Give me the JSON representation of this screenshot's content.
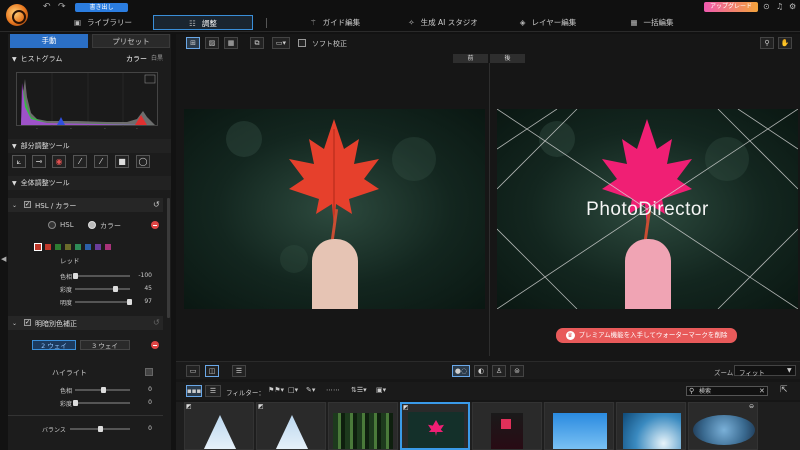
{
  "top": {
    "export_label": "書き出し",
    "upgrade_label": "アップグレード",
    "tabs": [
      {
        "label": "ライブラリー",
        "icon": "library-icon"
      },
      {
        "label": "調整",
        "icon": "adjust-icon"
      },
      {
        "label": "ガイド編集",
        "icon": "wand-icon"
      },
      {
        "label": "生成 AI スタジオ",
        "icon": "sparkle-icon"
      },
      {
        "label": "レイヤー編集",
        "icon": "layers-icon"
      },
      {
        "label": "一括編集",
        "icon": "batch-icon"
      }
    ]
  },
  "left": {
    "tab_manual": "手動",
    "tab_preset": "プリセット",
    "histogram_title": "ヒストグラム",
    "histogram_mode_color": "カラー",
    "histogram_mode_white": "白黒",
    "partial_tools_title": "部分調整ツール",
    "global_tools_title": "全体調整ツール",
    "hsl_title": "HSL / カラー",
    "hsl_option_hsl": "HSL",
    "hsl_option_color": "カラー",
    "color_name": "レッド",
    "sliders": [
      {
        "label": "色相",
        "value": "-100",
        "pos": 0.0
      },
      {
        "label": "彩度",
        "value": "45",
        "pos": 0.72
      },
      {
        "label": "明度",
        "value": "97",
        "pos": 0.98
      }
    ],
    "split_title": "明暗別色補正",
    "two_way": "2 ウェイ",
    "three_way": "3 ウェイ",
    "highlight_label": "ハイライト",
    "split_sliders": [
      {
        "label": "色相",
        "value": "0",
        "pos": 0.5
      },
      {
        "label": "彩度",
        "value": "0",
        "pos": 0.0
      }
    ],
    "balance_label": "バランス",
    "balance_value": "0",
    "balance_pos": 0.5
  },
  "toolbar": {
    "soft_proof_label": "ソフト校正"
  },
  "compare": {
    "before": "前",
    "after": "後"
  },
  "watermark_text": "PhotoDirector",
  "premium_message": "プレミアム機能を入手してウォーターマークを削除",
  "bottom": {
    "zoom_label": "ズーム：",
    "zoom_value": "フィット"
  },
  "filter": {
    "label": "フィルター：",
    "search_placeholder": "検索"
  },
  "colors": {
    "accent": "#2b7de0",
    "swatches": [
      "#c0392b",
      "#c0392b",
      "#2e7d32",
      "#6b6b2b",
      "#2e8b57",
      "#2c5fa8",
      "#6a3d9a",
      "#a83279"
    ]
  }
}
